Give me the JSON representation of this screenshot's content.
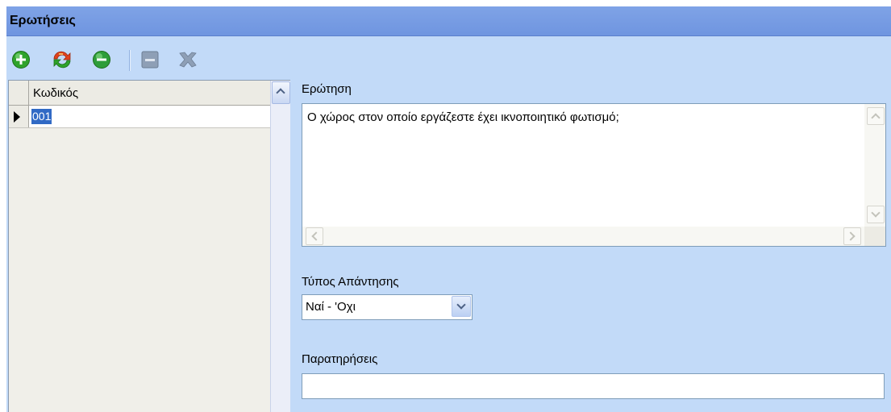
{
  "window": {
    "title": "Ερωτήσεις"
  },
  "toolbar": {
    "add": "add-icon",
    "refresh": "refresh-icon",
    "remove": "remove-icon",
    "save": "save-icon",
    "cancel": "cancel-icon"
  },
  "grid": {
    "column_header": "Κωδικός",
    "rows": [
      {
        "code": "001",
        "selected": true
      }
    ]
  },
  "form": {
    "question_label": "Ερώτηση",
    "question_value": "Ο χώρος στον οποίο εργάζεστε έχει ικνοποιητικό φωτισμό;",
    "answer_type_label": "Τύπος Απάντησης",
    "answer_type_value": "Ναί - 'Οχι",
    "notes_label": "Παρατηρήσεις",
    "notes_value": ""
  },
  "colors": {
    "title_bar": "#6f95e0",
    "window_bg": "#c2daf8",
    "selection": "#316ac5",
    "add_green": "#2fa32b",
    "remove_green": "#2e9d3a",
    "disabled_gray": "#8e9fb6"
  }
}
